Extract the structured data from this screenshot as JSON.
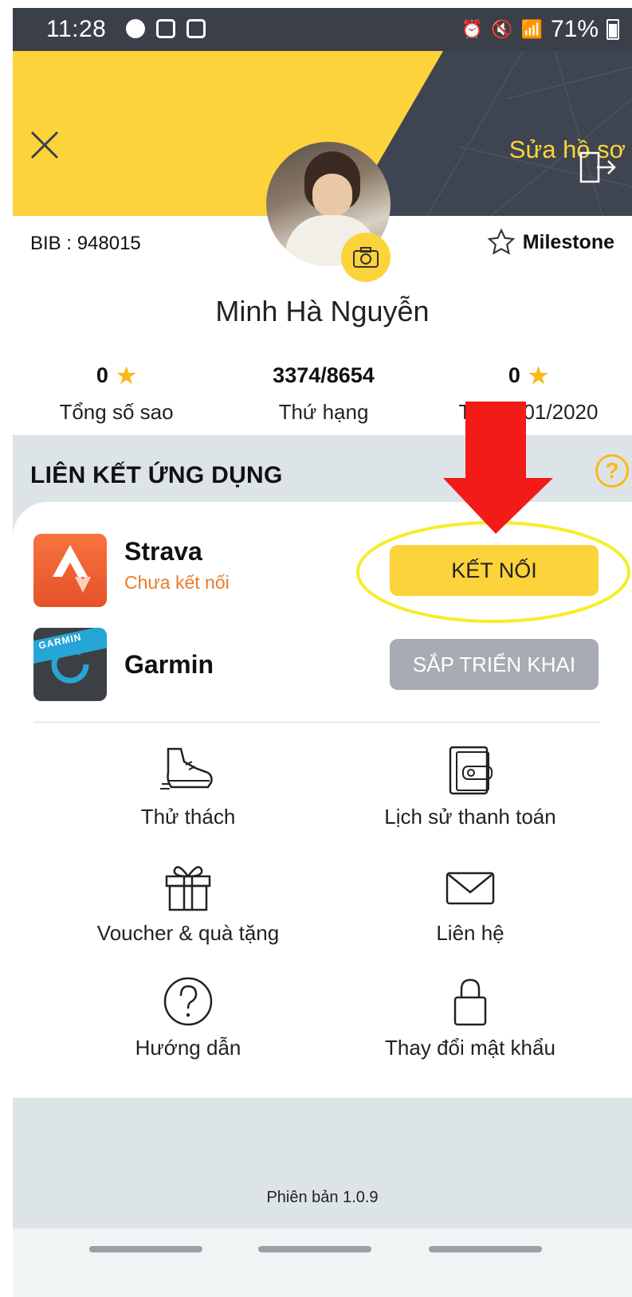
{
  "status_bar": {
    "time": "11:28",
    "battery": "71%",
    "icons_left": [
      "messenger-icon",
      "gmail-icon",
      "screen-icon"
    ],
    "icons_right": [
      "alarm-icon",
      "mute-icon",
      "wifi-icon",
      "signal-icon",
      "signal-icon",
      "battery-icon"
    ]
  },
  "header": {
    "edit_profile": "Sửa hồ sơ",
    "colors": {
      "yellow": "#fcd33b",
      "dark": "#3f4550"
    }
  },
  "profile": {
    "bib": "BIB : 948015",
    "milestone": "Milestone",
    "name": "Minh Hà Nguyễn"
  },
  "stats": [
    {
      "value": "0",
      "label": "Tổng số sao",
      "has_star": true
    },
    {
      "value": "3374/8654",
      "label": "Thứ hạng",
      "has_star": false
    },
    {
      "value": "0",
      "label": "Tháng 01/2020",
      "has_star": true
    }
  ],
  "apps_section": {
    "title": "LIÊN KẾT ỨNG DỤNG",
    "help": "?",
    "apps": [
      {
        "name": "Strava",
        "status": "Chưa kết nối",
        "button": "KẾT NỐI"
      },
      {
        "name": "Garmin",
        "status": "",
        "button": "SẮP TRIỂN KHAI",
        "logo_text": "GARMIN"
      }
    ]
  },
  "menu": [
    {
      "label": "Thử thách",
      "icon": "shoe-icon"
    },
    {
      "label": "Lịch sử thanh toán",
      "icon": "wallet-icon"
    },
    {
      "label": "Voucher & quà tặng",
      "icon": "gift-icon"
    },
    {
      "label": "Liên hệ",
      "icon": "mail-icon"
    },
    {
      "label": "Hướng dẫn",
      "icon": "help-circle-icon"
    },
    {
      "label": "Thay đổi mật khẩu",
      "icon": "lock-icon"
    }
  ],
  "footer": {
    "version": "Phiên bản 1.0.9"
  }
}
